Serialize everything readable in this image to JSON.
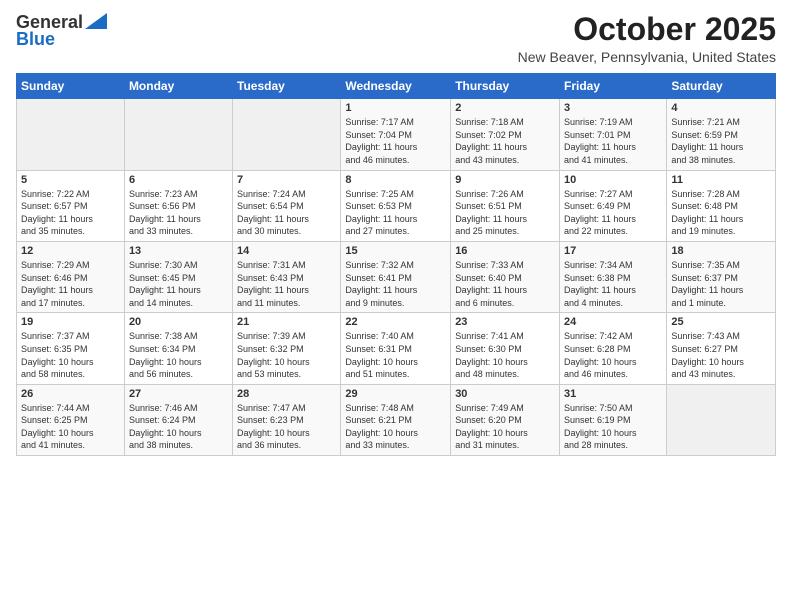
{
  "header": {
    "logo_line1": "General",
    "logo_line2": "Blue",
    "month": "October 2025",
    "location": "New Beaver, Pennsylvania, United States"
  },
  "weekdays": [
    "Sunday",
    "Monday",
    "Tuesday",
    "Wednesday",
    "Thursday",
    "Friday",
    "Saturday"
  ],
  "weeks": [
    [
      {
        "day": "",
        "info": ""
      },
      {
        "day": "",
        "info": ""
      },
      {
        "day": "",
        "info": ""
      },
      {
        "day": "1",
        "info": "Sunrise: 7:17 AM\nSunset: 7:04 PM\nDaylight: 11 hours\nand 46 minutes."
      },
      {
        "day": "2",
        "info": "Sunrise: 7:18 AM\nSunset: 7:02 PM\nDaylight: 11 hours\nand 43 minutes."
      },
      {
        "day": "3",
        "info": "Sunrise: 7:19 AM\nSunset: 7:01 PM\nDaylight: 11 hours\nand 41 minutes."
      },
      {
        "day": "4",
        "info": "Sunrise: 7:21 AM\nSunset: 6:59 PM\nDaylight: 11 hours\nand 38 minutes."
      }
    ],
    [
      {
        "day": "5",
        "info": "Sunrise: 7:22 AM\nSunset: 6:57 PM\nDaylight: 11 hours\nand 35 minutes."
      },
      {
        "day": "6",
        "info": "Sunrise: 7:23 AM\nSunset: 6:56 PM\nDaylight: 11 hours\nand 33 minutes."
      },
      {
        "day": "7",
        "info": "Sunrise: 7:24 AM\nSunset: 6:54 PM\nDaylight: 11 hours\nand 30 minutes."
      },
      {
        "day": "8",
        "info": "Sunrise: 7:25 AM\nSunset: 6:53 PM\nDaylight: 11 hours\nand 27 minutes."
      },
      {
        "day": "9",
        "info": "Sunrise: 7:26 AM\nSunset: 6:51 PM\nDaylight: 11 hours\nand 25 minutes."
      },
      {
        "day": "10",
        "info": "Sunrise: 7:27 AM\nSunset: 6:49 PM\nDaylight: 11 hours\nand 22 minutes."
      },
      {
        "day": "11",
        "info": "Sunrise: 7:28 AM\nSunset: 6:48 PM\nDaylight: 11 hours\nand 19 minutes."
      }
    ],
    [
      {
        "day": "12",
        "info": "Sunrise: 7:29 AM\nSunset: 6:46 PM\nDaylight: 11 hours\nand 17 minutes."
      },
      {
        "day": "13",
        "info": "Sunrise: 7:30 AM\nSunset: 6:45 PM\nDaylight: 11 hours\nand 14 minutes."
      },
      {
        "day": "14",
        "info": "Sunrise: 7:31 AM\nSunset: 6:43 PM\nDaylight: 11 hours\nand 11 minutes."
      },
      {
        "day": "15",
        "info": "Sunrise: 7:32 AM\nSunset: 6:41 PM\nDaylight: 11 hours\nand 9 minutes."
      },
      {
        "day": "16",
        "info": "Sunrise: 7:33 AM\nSunset: 6:40 PM\nDaylight: 11 hours\nand 6 minutes."
      },
      {
        "day": "17",
        "info": "Sunrise: 7:34 AM\nSunset: 6:38 PM\nDaylight: 11 hours\nand 4 minutes."
      },
      {
        "day": "18",
        "info": "Sunrise: 7:35 AM\nSunset: 6:37 PM\nDaylight: 11 hours\nand 1 minute."
      }
    ],
    [
      {
        "day": "19",
        "info": "Sunrise: 7:37 AM\nSunset: 6:35 PM\nDaylight: 10 hours\nand 58 minutes."
      },
      {
        "day": "20",
        "info": "Sunrise: 7:38 AM\nSunset: 6:34 PM\nDaylight: 10 hours\nand 56 minutes."
      },
      {
        "day": "21",
        "info": "Sunrise: 7:39 AM\nSunset: 6:32 PM\nDaylight: 10 hours\nand 53 minutes."
      },
      {
        "day": "22",
        "info": "Sunrise: 7:40 AM\nSunset: 6:31 PM\nDaylight: 10 hours\nand 51 minutes."
      },
      {
        "day": "23",
        "info": "Sunrise: 7:41 AM\nSunset: 6:30 PM\nDaylight: 10 hours\nand 48 minutes."
      },
      {
        "day": "24",
        "info": "Sunrise: 7:42 AM\nSunset: 6:28 PM\nDaylight: 10 hours\nand 46 minutes."
      },
      {
        "day": "25",
        "info": "Sunrise: 7:43 AM\nSunset: 6:27 PM\nDaylight: 10 hours\nand 43 minutes."
      }
    ],
    [
      {
        "day": "26",
        "info": "Sunrise: 7:44 AM\nSunset: 6:25 PM\nDaylight: 10 hours\nand 41 minutes."
      },
      {
        "day": "27",
        "info": "Sunrise: 7:46 AM\nSunset: 6:24 PM\nDaylight: 10 hours\nand 38 minutes."
      },
      {
        "day": "28",
        "info": "Sunrise: 7:47 AM\nSunset: 6:23 PM\nDaylight: 10 hours\nand 36 minutes."
      },
      {
        "day": "29",
        "info": "Sunrise: 7:48 AM\nSunset: 6:21 PM\nDaylight: 10 hours\nand 33 minutes."
      },
      {
        "day": "30",
        "info": "Sunrise: 7:49 AM\nSunset: 6:20 PM\nDaylight: 10 hours\nand 31 minutes."
      },
      {
        "day": "31",
        "info": "Sunrise: 7:50 AM\nSunset: 6:19 PM\nDaylight: 10 hours\nand 28 minutes."
      },
      {
        "day": "",
        "info": ""
      }
    ]
  ]
}
